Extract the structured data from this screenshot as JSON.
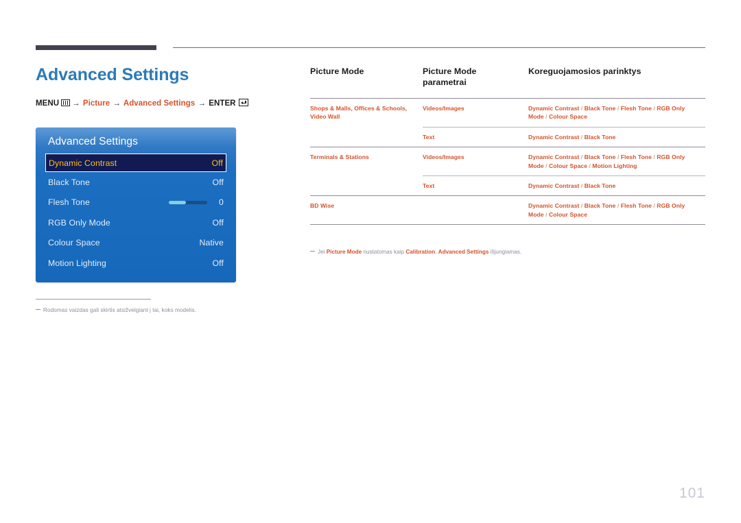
{
  "header": {
    "rule_color": "#454050"
  },
  "page": {
    "title": "Advanced Settings",
    "number": "101",
    "accent_color": "#d4522a",
    "title_color": "#2c7ab8"
  },
  "menu_path": {
    "menu_label": "MENU",
    "menu_icon": "menu-grid-icon",
    "arrow": "→",
    "step1": "Picture",
    "step2": "Advanced Settings",
    "enter_label": "ENTER",
    "enter_icon": "enter-return-icon"
  },
  "osd": {
    "title": "Advanced Settings",
    "rows": [
      {
        "label": "Dynamic Contrast",
        "value": "Off",
        "selected": true,
        "type": "value"
      },
      {
        "label": "Black Tone",
        "value": "Off",
        "selected": false,
        "type": "value"
      },
      {
        "label": "Flesh Tone",
        "value": "0",
        "selected": false,
        "type": "slider",
        "slider_percent": 44
      },
      {
        "label": "RGB Only Mode",
        "value": "Off",
        "selected": false,
        "type": "value"
      },
      {
        "label": "Colour Space",
        "value": "Native",
        "selected": false,
        "type": "value"
      },
      {
        "label": "Motion Lighting",
        "value": "Off",
        "selected": false,
        "type": "value"
      }
    ]
  },
  "left_note": {
    "text": "Rodomas vaizdas gali skirtis atsižvelgiant į tai, koks modelis."
  },
  "table": {
    "headers": {
      "col1": "Picture Mode",
      "col2_line1": "Picture Mode",
      "col2_line2": "parametrai",
      "col3": "Koreguojamosios parinktys"
    },
    "rows": [
      {
        "mode": "Shops & Malls, Offices & Schools, Video Wall",
        "subrows": [
          {
            "param": "Videos/Images",
            "options": "Dynamic Contrast / Black Tone / Flesh Tone / RGB Only Mode / Colour Space"
          },
          {
            "param": "Text",
            "options": "Dynamic Contrast / Black Tone"
          }
        ]
      },
      {
        "mode": "Terminals & Stations",
        "subrows": [
          {
            "param": "Videos/Images",
            "options": "Dynamic Contrast / Black Tone / Flesh Tone / RGB Only Mode / Colour Space / Motion Lighting"
          },
          {
            "param": "Text",
            "options": "Dynamic Contrast / Black Tone"
          }
        ]
      },
      {
        "mode": "BD Wise",
        "subrows": [
          {
            "param": "",
            "options": "Dynamic Contrast / Black Tone / Flesh Tone / RGB Only Mode / Colour Space"
          }
        ]
      }
    ]
  },
  "table_note": {
    "part1": "Jei ",
    "hl1": "Picture Mode",
    "part2": " nustatomas kaip ",
    "hl2": "Calibration",
    "part3": ", ",
    "hl3": "Advanced Settings",
    "part4": " išjungiamas."
  }
}
